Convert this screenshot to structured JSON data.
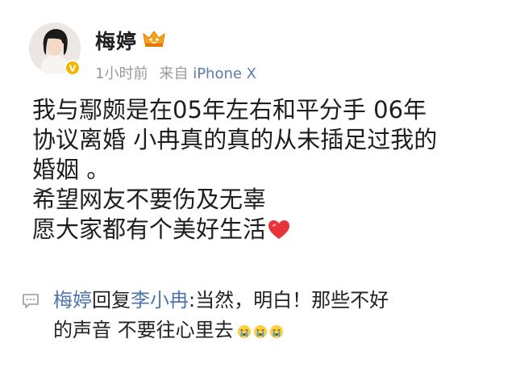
{
  "user": {
    "name": "梅婷",
    "time": "1小时前",
    "source_prefix": "来自",
    "source_device": "iPhone X",
    "avatar_icon": "user-avatar",
    "badge_icon": "verified-badge-icon",
    "vip_icon": "vip-crown-icon"
  },
  "post": {
    "lines": [
      "我与鄢颇是在05年左右和平分手  06年",
      "协议离婚 小冉真的真的从未插足过我的",
      "婚姻 。",
      "希望网友不要伤及无辜",
      "愿大家都有个美好生活"
    ],
    "trailing_icon": "red-heart-icon"
  },
  "reply": {
    "icon": "comment-bubble-icon",
    "author": "梅婷",
    "verb": "回复",
    "target": "李小冉",
    "line1_text": ":当然，明白！那些不好",
    "line2_text": "的声音 不要往心里去",
    "trailing_icons": [
      "crying-face-icon",
      "crying-face-icon",
      "crying-face-icon"
    ]
  },
  "colors": {
    "link_blue": "#4d74b0",
    "meta_gray": "#9a9a9a",
    "heart_red": "#e8333c",
    "badge_gold": "#f5b400"
  }
}
